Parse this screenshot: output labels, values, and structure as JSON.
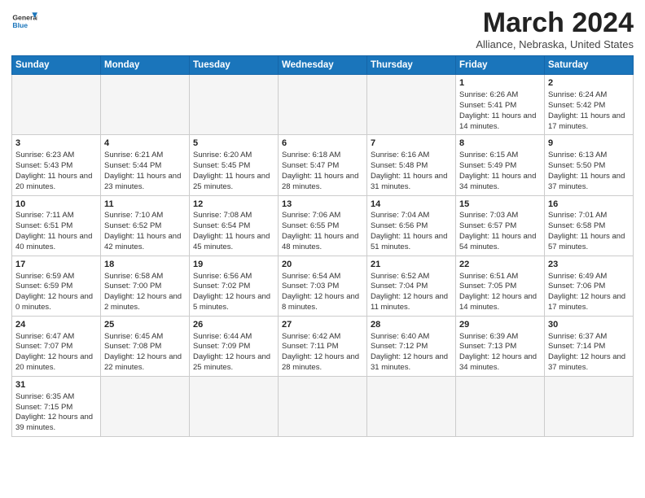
{
  "logo": {
    "line1": "General",
    "line2": "Blue"
  },
  "title": "March 2024",
  "subtitle": "Alliance, Nebraska, United States",
  "days_of_week": [
    "Sunday",
    "Monday",
    "Tuesday",
    "Wednesday",
    "Thursday",
    "Friday",
    "Saturday"
  ],
  "weeks": [
    [
      {
        "day": "",
        "info": ""
      },
      {
        "day": "",
        "info": ""
      },
      {
        "day": "",
        "info": ""
      },
      {
        "day": "",
        "info": ""
      },
      {
        "day": "",
        "info": ""
      },
      {
        "day": "1",
        "info": "Sunrise: 6:26 AM\nSunset: 5:41 PM\nDaylight: 11 hours and 14 minutes."
      },
      {
        "day": "2",
        "info": "Sunrise: 6:24 AM\nSunset: 5:42 PM\nDaylight: 11 hours and 17 minutes."
      }
    ],
    [
      {
        "day": "3",
        "info": "Sunrise: 6:23 AM\nSunset: 5:43 PM\nDaylight: 11 hours and 20 minutes."
      },
      {
        "day": "4",
        "info": "Sunrise: 6:21 AM\nSunset: 5:44 PM\nDaylight: 11 hours and 23 minutes."
      },
      {
        "day": "5",
        "info": "Sunrise: 6:20 AM\nSunset: 5:45 PM\nDaylight: 11 hours and 25 minutes."
      },
      {
        "day": "6",
        "info": "Sunrise: 6:18 AM\nSunset: 5:47 PM\nDaylight: 11 hours and 28 minutes."
      },
      {
        "day": "7",
        "info": "Sunrise: 6:16 AM\nSunset: 5:48 PM\nDaylight: 11 hours and 31 minutes."
      },
      {
        "day": "8",
        "info": "Sunrise: 6:15 AM\nSunset: 5:49 PM\nDaylight: 11 hours and 34 minutes."
      },
      {
        "day": "9",
        "info": "Sunrise: 6:13 AM\nSunset: 5:50 PM\nDaylight: 11 hours and 37 minutes."
      }
    ],
    [
      {
        "day": "10",
        "info": "Sunrise: 7:11 AM\nSunset: 6:51 PM\nDaylight: 11 hours and 40 minutes."
      },
      {
        "day": "11",
        "info": "Sunrise: 7:10 AM\nSunset: 6:52 PM\nDaylight: 11 hours and 42 minutes."
      },
      {
        "day": "12",
        "info": "Sunrise: 7:08 AM\nSunset: 6:54 PM\nDaylight: 11 hours and 45 minutes."
      },
      {
        "day": "13",
        "info": "Sunrise: 7:06 AM\nSunset: 6:55 PM\nDaylight: 11 hours and 48 minutes."
      },
      {
        "day": "14",
        "info": "Sunrise: 7:04 AM\nSunset: 6:56 PM\nDaylight: 11 hours and 51 minutes."
      },
      {
        "day": "15",
        "info": "Sunrise: 7:03 AM\nSunset: 6:57 PM\nDaylight: 11 hours and 54 minutes."
      },
      {
        "day": "16",
        "info": "Sunrise: 7:01 AM\nSunset: 6:58 PM\nDaylight: 11 hours and 57 minutes."
      }
    ],
    [
      {
        "day": "17",
        "info": "Sunrise: 6:59 AM\nSunset: 6:59 PM\nDaylight: 12 hours and 0 minutes."
      },
      {
        "day": "18",
        "info": "Sunrise: 6:58 AM\nSunset: 7:00 PM\nDaylight: 12 hours and 2 minutes."
      },
      {
        "day": "19",
        "info": "Sunrise: 6:56 AM\nSunset: 7:02 PM\nDaylight: 12 hours and 5 minutes."
      },
      {
        "day": "20",
        "info": "Sunrise: 6:54 AM\nSunset: 7:03 PM\nDaylight: 12 hours and 8 minutes."
      },
      {
        "day": "21",
        "info": "Sunrise: 6:52 AM\nSunset: 7:04 PM\nDaylight: 12 hours and 11 minutes."
      },
      {
        "day": "22",
        "info": "Sunrise: 6:51 AM\nSunset: 7:05 PM\nDaylight: 12 hours and 14 minutes."
      },
      {
        "day": "23",
        "info": "Sunrise: 6:49 AM\nSunset: 7:06 PM\nDaylight: 12 hours and 17 minutes."
      }
    ],
    [
      {
        "day": "24",
        "info": "Sunrise: 6:47 AM\nSunset: 7:07 PM\nDaylight: 12 hours and 20 minutes."
      },
      {
        "day": "25",
        "info": "Sunrise: 6:45 AM\nSunset: 7:08 PM\nDaylight: 12 hours and 22 minutes."
      },
      {
        "day": "26",
        "info": "Sunrise: 6:44 AM\nSunset: 7:09 PM\nDaylight: 12 hours and 25 minutes."
      },
      {
        "day": "27",
        "info": "Sunrise: 6:42 AM\nSunset: 7:11 PM\nDaylight: 12 hours and 28 minutes."
      },
      {
        "day": "28",
        "info": "Sunrise: 6:40 AM\nSunset: 7:12 PM\nDaylight: 12 hours and 31 minutes."
      },
      {
        "day": "29",
        "info": "Sunrise: 6:39 AM\nSunset: 7:13 PM\nDaylight: 12 hours and 34 minutes."
      },
      {
        "day": "30",
        "info": "Sunrise: 6:37 AM\nSunset: 7:14 PM\nDaylight: 12 hours and 37 minutes."
      }
    ],
    [
      {
        "day": "31",
        "info": "Sunrise: 6:35 AM\nSunset: 7:15 PM\nDaylight: 12 hours and 39 minutes."
      },
      {
        "day": "",
        "info": ""
      },
      {
        "day": "",
        "info": ""
      },
      {
        "day": "",
        "info": ""
      },
      {
        "day": "",
        "info": ""
      },
      {
        "day": "",
        "info": ""
      },
      {
        "day": "",
        "info": ""
      }
    ]
  ]
}
